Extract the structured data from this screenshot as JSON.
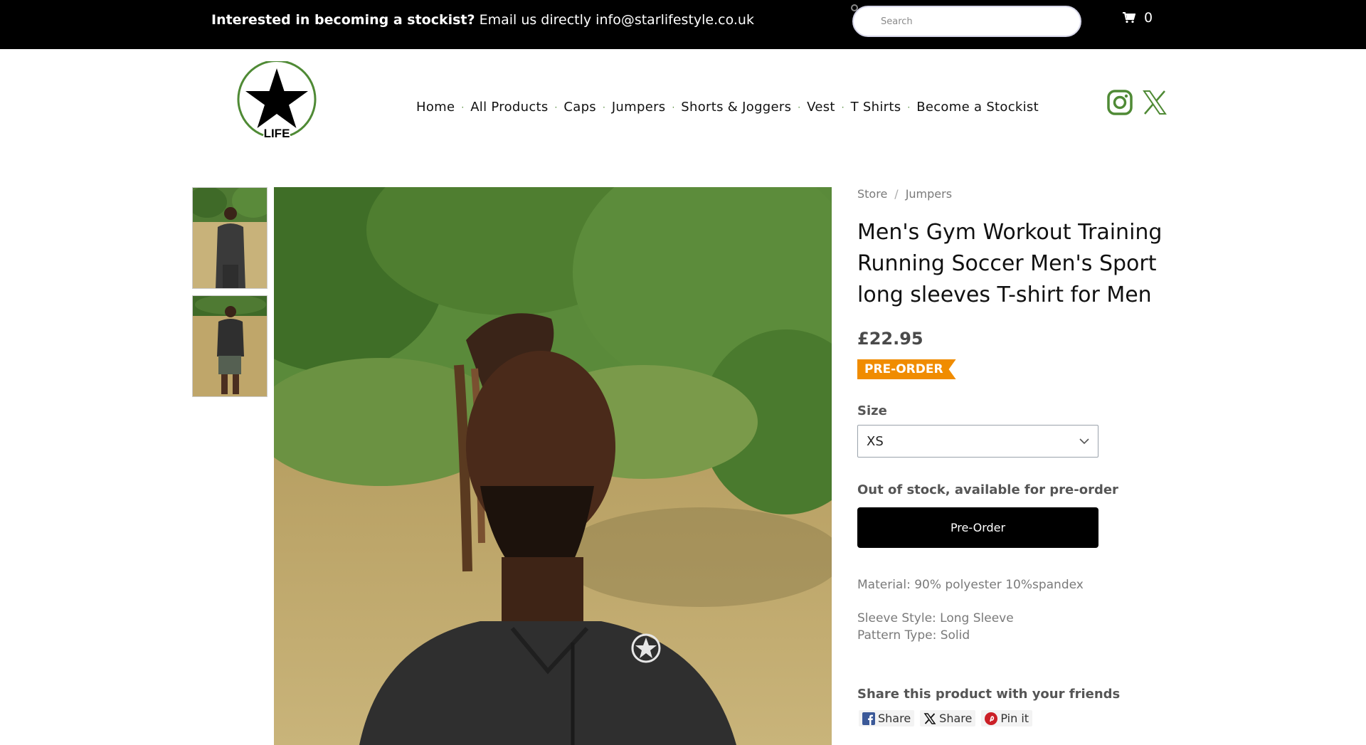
{
  "topbar": {
    "promo_bold": "Interested in becoming a stockist?",
    "promo_rest": " Email us directly info@starlifestyle.co.uk",
    "search_placeholder": "Search",
    "cart_count": "0"
  },
  "logo": {
    "text": "LIFE",
    "brand_color": "#4f8a35"
  },
  "nav": {
    "items": [
      "Home",
      "All Products",
      "Caps",
      "Jumpers",
      "Shorts & Joggers",
      "Vest",
      "T Shirts",
      "Become a Stockist"
    ],
    "separator": "·"
  },
  "social": {
    "icons": [
      "instagram-icon",
      "x-twitter-icon"
    ],
    "color": "#4f8a35"
  },
  "product": {
    "breadcrumb": [
      "Store",
      "Jumpers"
    ],
    "breadcrumb_sep": "/",
    "title": "Men's Gym Workout Training Running Soccer Men's Sport long sleeves T-shirt for Men",
    "price": "£22.95",
    "badge": "PRE-ORDER",
    "badge_color": "#f08c00",
    "size_label": "Size",
    "size_value": "XS",
    "stock_status": "Out of stock, available for pre-order",
    "button_label": "Pre-Order",
    "material": "Material: 90% polyester 10%spandex",
    "sleeve": "Sleeve Style: Long Sleeve",
    "pattern": "Pattern Type: Solid",
    "share_title": "Share this product with your friends",
    "share": [
      {
        "label": "Share",
        "icon": "facebook-icon"
      },
      {
        "label": "Share",
        "icon": "x-icon"
      },
      {
        "label": "Pin it",
        "icon": "pinterest-icon"
      }
    ]
  }
}
